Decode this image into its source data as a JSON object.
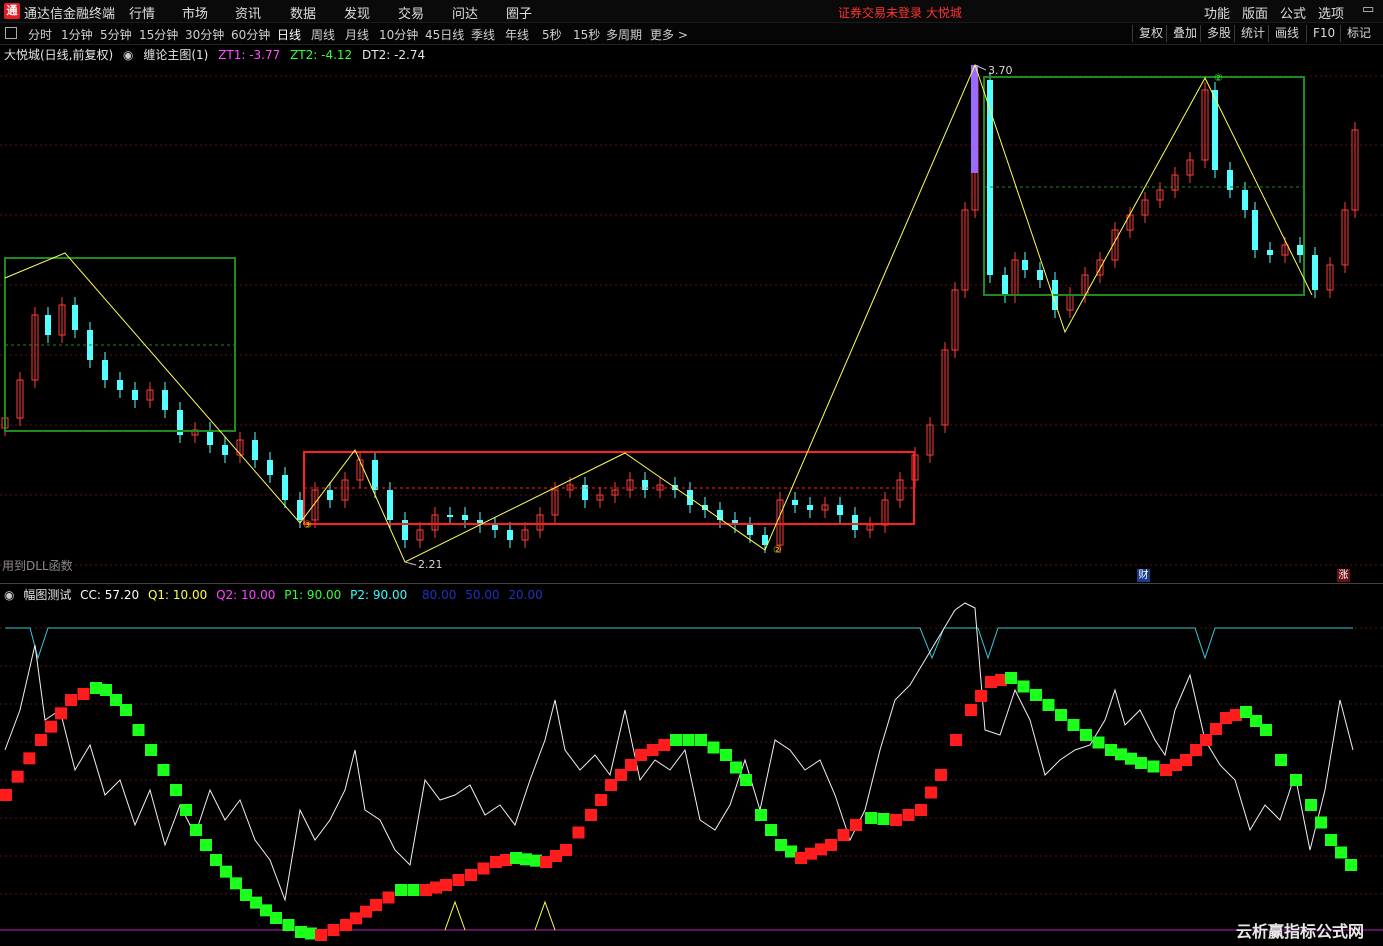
{
  "app": {
    "logo": "通",
    "title": "通达信金融终端"
  },
  "menu": [
    "行情",
    "市场",
    "资讯",
    "数据",
    "发现",
    "交易",
    "问达",
    "圈子"
  ],
  "right_menu": [
    "功能",
    "版面",
    "公式",
    "选项"
  ],
  "trade_status": "证券交易未登录  大悦城",
  "window_controls": "▭",
  "periods": [
    "分时",
    "1分钟",
    "5分钟",
    "15分钟",
    "30分钟",
    "60分钟",
    "日线",
    "周线",
    "月线",
    "10分钟",
    "45日线",
    "季线",
    "年线",
    "5秒",
    "15秒",
    "多周期",
    "更多 >"
  ],
  "active_period": "日线",
  "tools": [
    "复权",
    "叠加",
    "多股",
    "统计",
    "画线",
    "F10",
    "标记"
  ],
  "main": {
    "stock": "大悦城(日线,前复权)",
    "indicator": "缠论主图(1)",
    "zt1": "ZT1: -3.77",
    "zt2": "ZT2: -4.12",
    "dt2": "DT2: -2.74",
    "high_label": "3.70",
    "low_label": "2.21",
    "pivot_marks": [
      "③",
      "②",
      "②"
    ],
    "dll_note": "用到DLL函数"
  },
  "badges": {
    "cai": "财",
    "zhang": "涨"
  },
  "sub": {
    "name": "幅图测试",
    "cc": "CC: 57.20",
    "q1": "Q1: 10.00",
    "q2": "Q2: 10.00",
    "p1": "P1: 90.00",
    "p2": "P2: 90.00",
    "l80": "80.00",
    "l50": "50.00",
    "l20": "20.00"
  },
  "colors": {
    "up": "#ff3c3c",
    "down": "#54ffff",
    "box_green": "#1f8a1f",
    "box_red": "#ff2020",
    "zigzag": "#ffff55",
    "high_bar": "#9b6bff"
  },
  "watermark": "云析赢指标公式网"
}
